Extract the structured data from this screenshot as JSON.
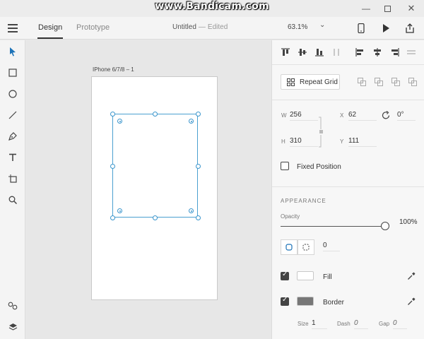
{
  "watermark": "www.Bandicam.com",
  "header": {
    "tabs": [
      {
        "label": "Design"
      },
      {
        "label": "Prototype"
      }
    ],
    "doc_title": "Untitled",
    "doc_sep": "—",
    "doc_status": "Edited",
    "zoom": "63.1%"
  },
  "canvas": {
    "artboard_label": "IPhone 6/7/8 – 1"
  },
  "panel": {
    "repeat_grid_label": "Repeat Grid",
    "transform": {
      "w_label": "W",
      "w_value": "256",
      "h_label": "H",
      "h_value": "310",
      "x_label": "X",
      "x_value": "62",
      "y_label": "Y",
      "y_value": "111",
      "rotation": "0°"
    },
    "fixed_position_label": "Fixed Position",
    "appearance_heading": "APPEARANCE",
    "opacity_label": "Opacity",
    "opacity_value": "100%",
    "opacity_fraction": 1.0,
    "corner_radius_value": "0",
    "fill_label": "Fill",
    "fill_color": "#ffffff",
    "border_label": "Border",
    "border_color": "#777777",
    "border_size_label": "Size",
    "border_size_value": "1",
    "border_dash_label": "Dash",
    "border_dash_value": "0",
    "border_gap_label": "Gap",
    "border_gap_value": "0"
  },
  "colors": {
    "selection": "#3a95cc",
    "accent_dark": "#333333"
  }
}
